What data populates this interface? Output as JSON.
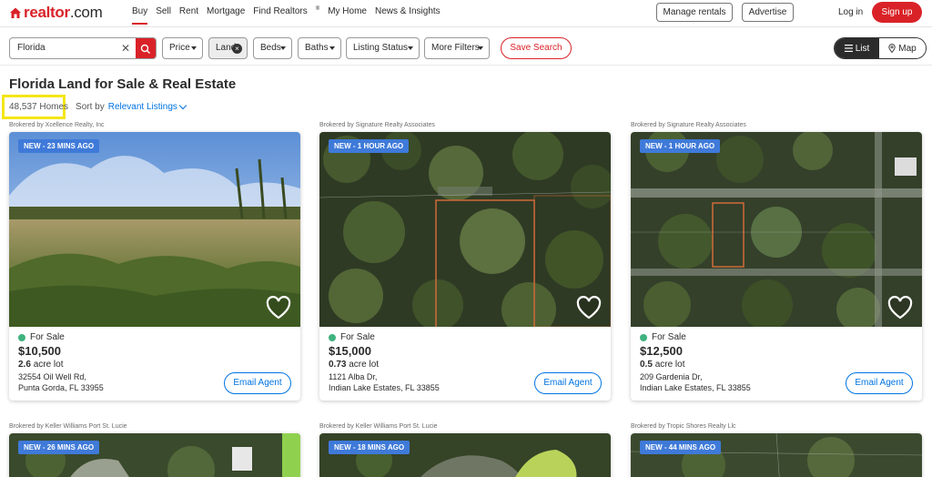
{
  "header": {
    "logo_main": "realtor",
    "logo_suffix": ".com",
    "nav": [
      {
        "label": "Buy"
      },
      {
        "label": "Sell"
      },
      {
        "label": "Rent"
      },
      {
        "label": "Mortgage"
      },
      {
        "label": "Find Realtors",
        "sup": "®"
      },
      {
        "label": "My Home"
      },
      {
        "label": "News & Insights"
      }
    ],
    "manage_rentals": "Manage rentals",
    "advertise": "Advertise",
    "login": "Log in",
    "signup": "Sign up"
  },
  "filters": {
    "search_value": "Florida",
    "clear_glyph": "✕",
    "price": "Price",
    "land": "Land",
    "land_clear": "×",
    "beds": "Beds",
    "baths": "Baths",
    "listing_status": "Listing Status",
    "more_filters": "More Filters",
    "save_search": "Save Search",
    "view_list": "List",
    "view_map": "Map"
  },
  "results": {
    "title": "Florida Land for Sale & Real Estate",
    "count": "48,537 Homes",
    "sort_label": "Sort by",
    "sort_value": "Relevant Listings"
  },
  "listings": [
    {
      "broker": "Brokered by Xcellence Realty, Inc",
      "badge": "NEW - 23 MINS AGO",
      "status": "For Sale",
      "price": "$10,500",
      "lot_size": "2.6",
      "lot_unit": "acre lot",
      "address1": "32554 Oil Well Rd,",
      "address2": "Punta Gorda, FL 33955",
      "cta": "Email Agent"
    },
    {
      "broker": "Brokered by Signature Realty Associates",
      "badge": "NEW - 1 HOUR AGO",
      "status": "For Sale",
      "price": "$15,000",
      "lot_size": "0.73",
      "lot_unit": "acre lot",
      "address1": "1121 Alba Dr,",
      "address2": "Indian Lake Estates, FL 33855",
      "cta": "Email Agent"
    },
    {
      "broker": "Brokered by Signature Realty Associates",
      "badge": "NEW - 1 HOUR AGO",
      "status": "For Sale",
      "price": "$12,500",
      "lot_size": "0.5",
      "lot_unit": "acre lot",
      "address1": "209 Gardenia Dr,",
      "address2": "Indian Lake Estates, FL 33855",
      "cta": "Email Agent"
    },
    {
      "broker": "Brokered by Keller Williams Port St. Lucie",
      "badge": "NEW - 26 MINS AGO"
    },
    {
      "broker": "Brokered by Keller Williams Port St. Lucie",
      "badge": "NEW - 18 MINS AGO"
    },
    {
      "broker": "Brokered by Tropic Shores Realty Llc",
      "badge": "NEW - 44 MINS AGO"
    }
  ],
  "colors": {
    "brand_red": "#d92228",
    "link_blue": "#0073e1",
    "badge_blue": "#3f7ad9",
    "status_green": "#3fb27f",
    "highlight_yellow": "#f5e616"
  }
}
